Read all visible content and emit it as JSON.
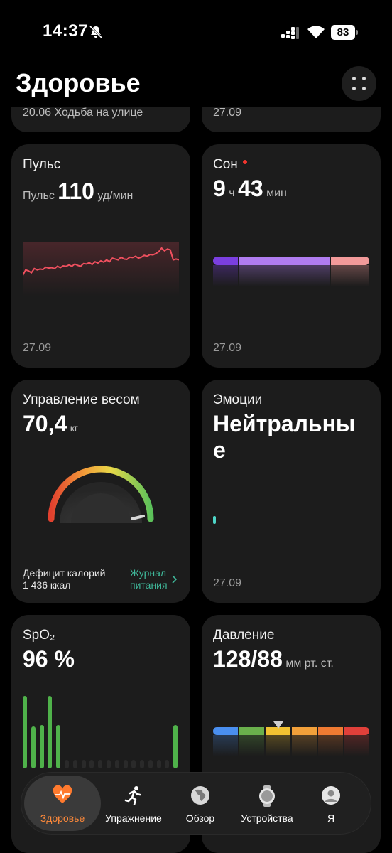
{
  "status": {
    "time": "14:37",
    "battery": "83"
  },
  "header": {
    "title": "Здоровье"
  },
  "top_cards": {
    "left_text": "20.06 Ходьба на улице",
    "right_text": "27.09"
  },
  "pulse": {
    "title": "Пульс",
    "prefix": "Пульс",
    "value": "110",
    "unit": "уд/мин",
    "date": "27.09",
    "trend": [
      40,
      52,
      50,
      46,
      55,
      52,
      54,
      53,
      58,
      56,
      57,
      55,
      60,
      57,
      61,
      60,
      63,
      60,
      65,
      62,
      60,
      66,
      65,
      68,
      64,
      70,
      67,
      72,
      69,
      74,
      70,
      78,
      76,
      74,
      80,
      76,
      75,
      80,
      79,
      82,
      78,
      80,
      84,
      82,
      86,
      85,
      88,
      92,
      100,
      94,
      98,
      96,
      74,
      76,
      74
    ]
  },
  "sleep": {
    "title": "Сон",
    "hours": "9",
    "h_unit": "ч",
    "minutes": "43",
    "m_unit": "мин",
    "date": "27.09",
    "segments": [
      {
        "share": 0.16,
        "color": "#7b3fe0"
      },
      {
        "share": 0.59,
        "color": "#b07cf0"
      },
      {
        "share": 0.25,
        "color": "#f29a9a"
      }
    ]
  },
  "weight": {
    "title": "Управление весом",
    "value": "70,4",
    "unit": "кг",
    "deficit_label": "Дефицит калорий",
    "deficit_value": "1 436 ккал",
    "link_line1": "Журнал",
    "link_line2": "питания"
  },
  "emotions": {
    "title": "Эмоции",
    "value_line1": "Нейтральны",
    "value_line2": "е",
    "date": "27.09"
  },
  "spo2": {
    "title": "SpO₂",
    "value": "96 %",
    "bars": [
      100,
      58,
      60,
      100,
      60,
      0,
      0,
      0,
      0,
      0,
      0,
      0,
      0,
      0,
      0,
      0,
      0,
      0,
      60
    ]
  },
  "pressure": {
    "title": "Давление",
    "value": "128/88",
    "unit": "мм рт. ст.",
    "scale": [
      "#4a8ff0",
      "#6ab04c",
      "#f2c232",
      "#f2a03a",
      "#ef7a32",
      "#e0403a"
    ],
    "marker_index": 2
  },
  "nav": [
    {
      "label": "Здоровье",
      "icon": "heart-pulse-icon",
      "active": true
    },
    {
      "label": "Упражнение",
      "icon": "running-icon",
      "active": false
    },
    {
      "label": "Обзор",
      "icon": "globe-icon",
      "active": false
    },
    {
      "label": "Устройства",
      "icon": "watch-icon",
      "active": false
    },
    {
      "label": "Я",
      "icon": "profile-icon",
      "active": false
    }
  ]
}
